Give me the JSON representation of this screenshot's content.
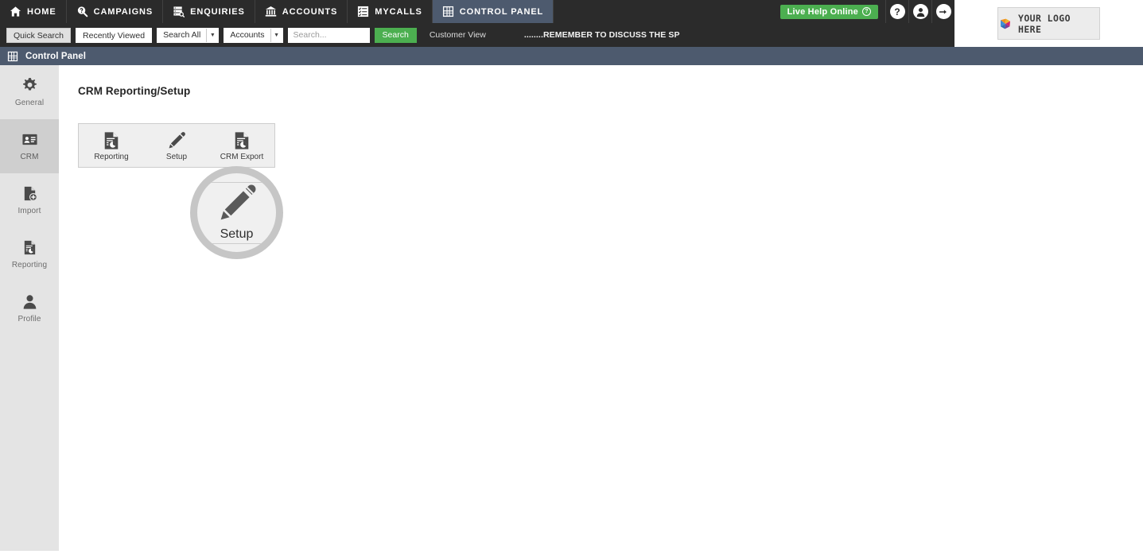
{
  "topnav": {
    "tabs": [
      {
        "label": "HOME",
        "icon": "home-icon",
        "active": false
      },
      {
        "label": "CAMPAIGNS",
        "icon": "campaigns-icon",
        "active": false
      },
      {
        "label": "ENQUIRIES",
        "icon": "enquiries-icon",
        "active": false
      },
      {
        "label": "ACCOUNTS",
        "icon": "accounts-bank-icon",
        "active": false
      },
      {
        "label": "MYCALLS",
        "icon": "mycalls-list-icon",
        "active": false
      },
      {
        "label": "CONTROL PANEL",
        "icon": "control-panel-grid-icon",
        "active": true
      }
    ],
    "live_help_label": "Live Help Online",
    "live_help_badge": "?",
    "help_icon_glyph": "?",
    "profile_icon": "user-avatar-icon",
    "logout_icon": "logout-arrow-icon",
    "accent_green": "#4caf50",
    "bar_background": "#2b2b2b",
    "active_tab_background": "#4d5a6e"
  },
  "searchbar": {
    "quick_search_label": "Quick Search",
    "recently_viewed_label": "Recently Viewed",
    "scope_select_value": "Search All",
    "entity_select_value": "Accounts",
    "search_placeholder": "Search...",
    "search_value": "",
    "search_button_label": "Search",
    "customer_view_label": "Customer View",
    "marquee_text": "........REMEMBER TO DISCUSS THE SP"
  },
  "logo": {
    "text": "YOUR LOGO HERE",
    "mark_icon": "pinwheel-logo-icon",
    "mark_colors": [
      "#f0901e",
      "#2f6fb5",
      "#7b3f98",
      "#d6226b"
    ]
  },
  "section": {
    "title": "Control Panel",
    "icon": "control-panel-grid-icon",
    "background": "#4d5a6e"
  },
  "sidebar": {
    "items": [
      {
        "label": "General",
        "icon": "gear-icon",
        "active": false
      },
      {
        "label": "CRM",
        "icon": "contact-card-icon",
        "active": true
      },
      {
        "label": "Import",
        "icon": "document-add-icon",
        "active": false
      },
      {
        "label": "Reporting",
        "icon": "document-chart-icon",
        "active": false
      },
      {
        "label": "Profile",
        "icon": "person-icon",
        "active": false
      }
    ],
    "active_background": "#cfcfcf",
    "background": "#e4e4e4"
  },
  "main": {
    "page_title": "CRM Reporting/Setup",
    "tiles": [
      {
        "label": "Reporting",
        "icon": "document-chart-icon"
      },
      {
        "label": "Setup",
        "icon": "pencil-icon"
      },
      {
        "label": "CRM Export",
        "icon": "document-chart-icon"
      }
    ]
  },
  "magnifier": {
    "label": "Setup",
    "icon": "pencil-icon",
    "ring_color": "#c6c6c6",
    "inner_background": "#f0f0f0"
  }
}
